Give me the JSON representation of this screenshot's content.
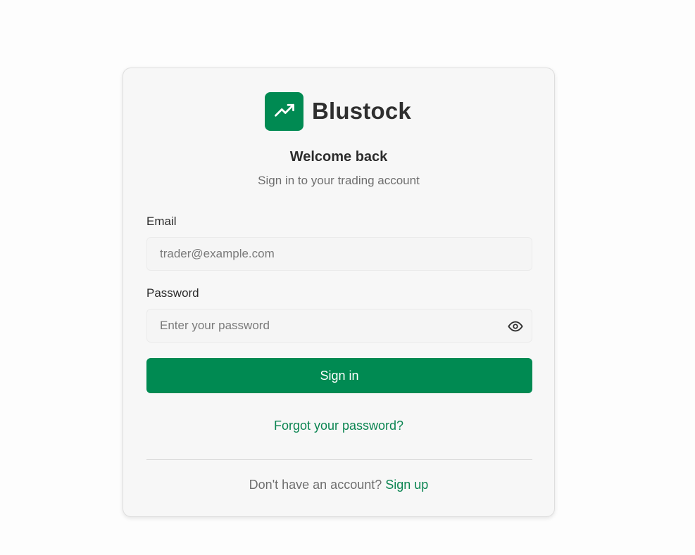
{
  "brand": {
    "name": "Blustock",
    "logo_icon": "trending-up-icon",
    "accent_color": "#008a52"
  },
  "header": {
    "title": "Welcome back",
    "subtitle": "Sign in to your trading account"
  },
  "form": {
    "email": {
      "label": "Email",
      "placeholder": "trader@example.com",
      "value": ""
    },
    "password": {
      "label": "Password",
      "placeholder": "Enter your password",
      "value": "",
      "toggle_icon": "eye-icon"
    },
    "submit_label": "Sign in"
  },
  "links": {
    "forgot_password": "Forgot your password?",
    "signup_prompt": "Don't have an account?",
    "signup_label": "Sign up"
  }
}
